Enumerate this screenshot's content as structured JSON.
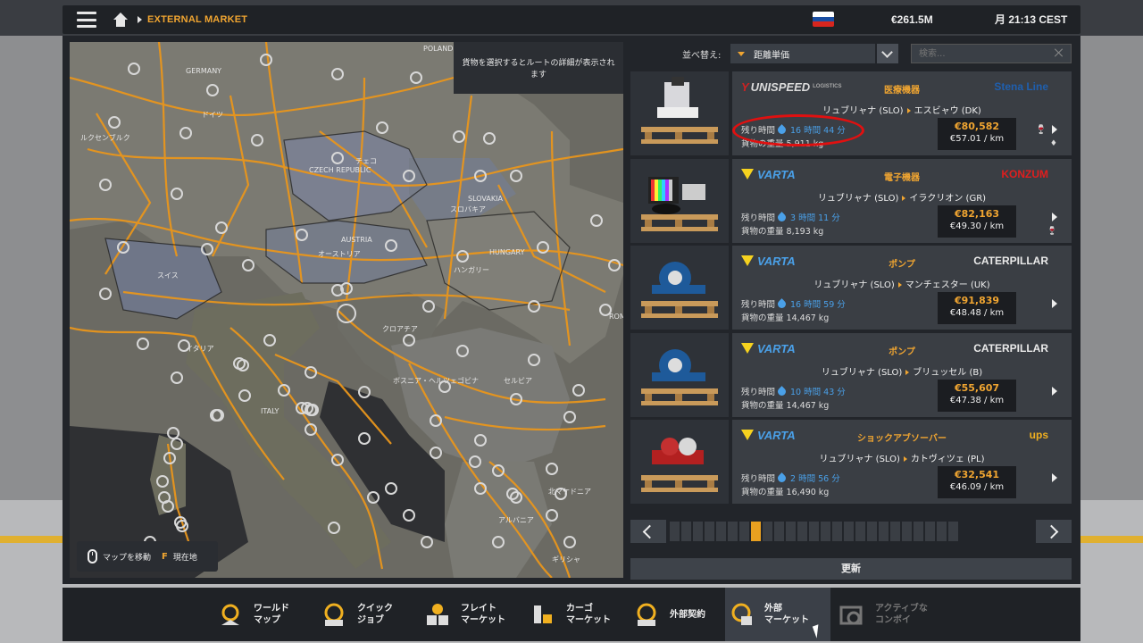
{
  "topbar": {
    "breadcrumb": "EXTERNAL MARKET",
    "money": "€261.5M",
    "clock": "月 21:13 CEST",
    "flag_colors": [
      "#ffffff",
      "#1a4fa3",
      "#d7261e"
    ]
  },
  "map": {
    "tooltip": "貨物を選択するとルートの詳細が表示されます",
    "labels": {
      "poland": "POLAND",
      "germany": "GERMANY",
      "germany_jp": "ドイツ",
      "luxembourg": "ルクセンブルク",
      "czech": "CZECH REPUBLIC",
      "czech_jp": "チェコ",
      "slovakia": "SLOVAKIA",
      "slovakia_jp": "スロバキア",
      "austria": "AUSTRIA",
      "austria_jp": "オーストリア",
      "hungary": "HUNGARY",
      "hungary_jp": "ハンガリー",
      "swiss_jp": "スイス",
      "italy": "ITALY",
      "italy_jp": "イタリア",
      "croatia_jp": "クロアチア",
      "bosnia_jp": "ボスニア・ヘルツェゴビナ",
      "serbia_jp": "セルビア",
      "albania_jp": "アルバニア",
      "greece_jp": "ギリシャ",
      "romania": "ROM",
      "macedonia_jp": "北マケドニア"
    },
    "move_hint": "マップを移動",
    "key_f": "F",
    "current_location": "現在地"
  },
  "sort": {
    "label": "並べ替え:",
    "value": "距離単価",
    "search_placeholder": "検索..."
  },
  "jobs": [
    {
      "company": "UNISPEED",
      "company_sub": "LOGISTICS",
      "cargo": "医療機器",
      "destination_company": "Stena Line",
      "from": "リュブリャナ (SLO)",
      "to": "エスビャウ (DK)",
      "time_label": "残り時間",
      "time": "16 時間 44 分",
      "weight_label": "貨物の重量",
      "weight": "5,911 kg",
      "price": "€80,582",
      "per_km": "€57.01 / km"
    },
    {
      "company": "VARTA",
      "cargo": "電子機器",
      "destination_company": "KONZUM",
      "from": "リュブリャナ (SLO)",
      "to": "イラクリオン (GR)",
      "time_label": "残り時間",
      "time": "3 時間 11 分",
      "weight_label": "貨物の重量",
      "weight": "8,193 kg",
      "price": "€82,163",
      "per_km": "€49.30 / km"
    },
    {
      "company": "VARTA",
      "cargo": "ポンプ",
      "destination_company": "CATERPILLAR",
      "from": "リュブリャナ (SLO)",
      "to": "マンチェスター (UK)",
      "time_label": "残り時間",
      "time": "16 時間 59 分",
      "weight_label": "貨物の重量",
      "weight": "14,467 kg",
      "price": "€91,839",
      "per_km": "€48.48 / km"
    },
    {
      "company": "VARTA",
      "cargo": "ポンプ",
      "destination_company": "CATERPILLAR",
      "from": "リュブリャナ (SLO)",
      "to": "ブリュッセル (B)",
      "time_label": "残り時間",
      "time": "10 時間 43 分",
      "weight_label": "貨物の重量",
      "weight": "14,467 kg",
      "price": "€55,607",
      "per_km": "€47.38 / km"
    },
    {
      "company": "VARTA",
      "cargo": "ショックアブソーバー",
      "destination_company": "ups",
      "from": "リュブリャナ (SLO)",
      "to": "カトヴィツェ (PL)",
      "time_label": "残り時間",
      "time": "2 時間 56 分",
      "weight_label": "貨物の重量",
      "weight": "16,490 kg",
      "price": "€32,541",
      "per_km": "€46.09 / km"
    }
  ],
  "pager": {
    "total": 25,
    "active": 8
  },
  "refresh_label": "更新",
  "nav": [
    {
      "line1": "ワールド",
      "line2": "マップ",
      "icon": "world-map-icon"
    },
    {
      "line1": "クイック",
      "line2": "ジョブ",
      "icon": "quick-job-icon"
    },
    {
      "line1": "フレイト",
      "line2": "マーケット",
      "icon": "freight-market-icon"
    },
    {
      "line1": "カーゴ",
      "line2": "マーケット",
      "icon": "cargo-market-icon"
    },
    {
      "line1": "外部契約",
      "line2": "",
      "icon": "external-contracts-icon"
    },
    {
      "line1": "外部",
      "line2": "マーケット",
      "icon": "external-market-icon"
    },
    {
      "line1": "アクティブな",
      "line2": "コンボイ",
      "icon": "active-convoy-icon"
    }
  ],
  "colors": {
    "accent": "#f0a531",
    "time_blue": "#4aa0e8",
    "highlight_red": "#e01010"
  }
}
